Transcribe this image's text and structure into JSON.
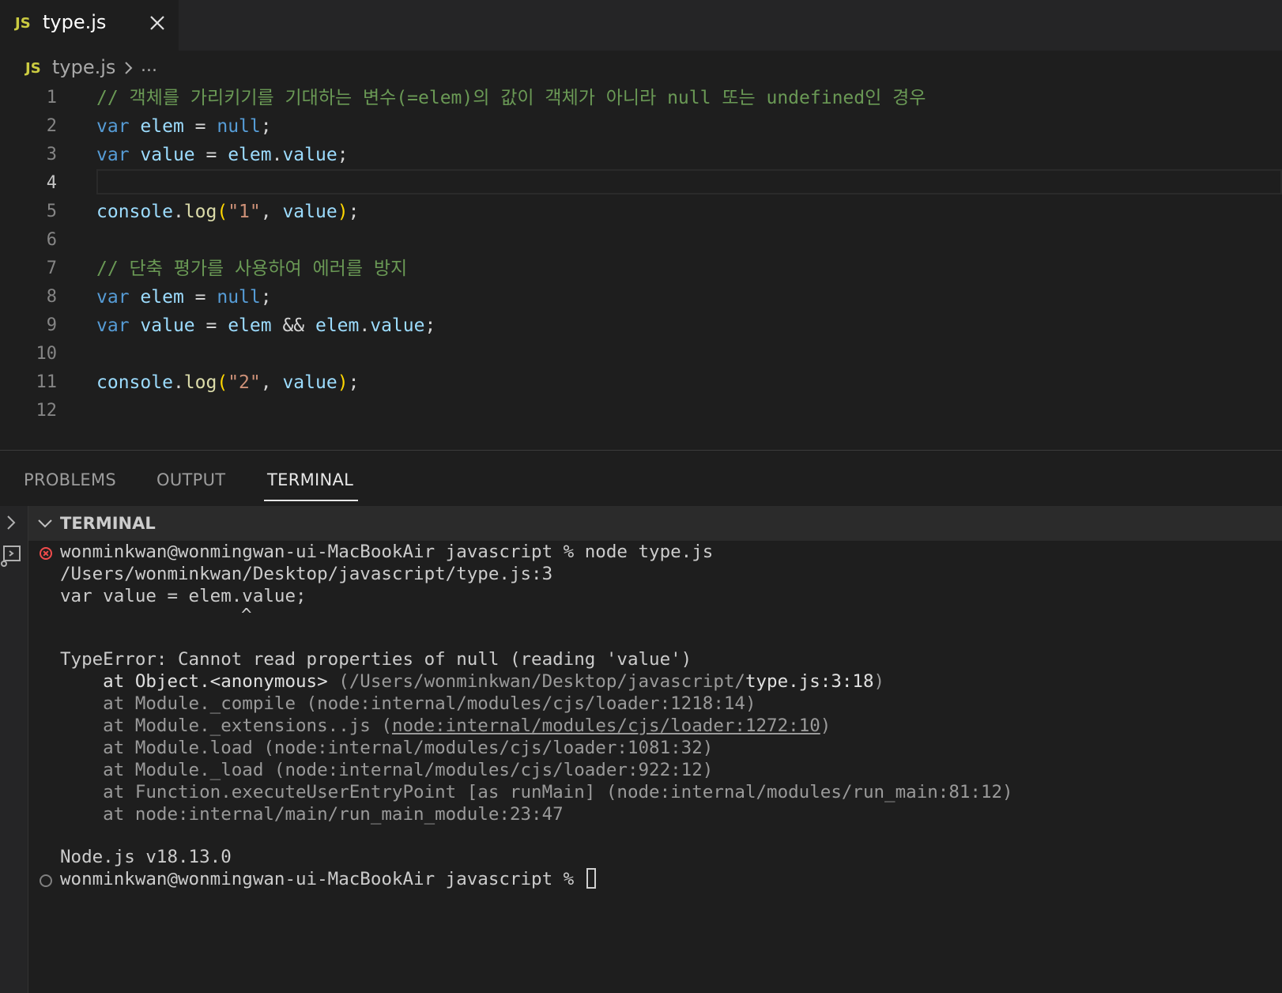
{
  "tab": {
    "icon_label": "JS",
    "filename": "type.js"
  },
  "breadcrumb": {
    "icon_label": "JS",
    "file": "type.js",
    "more": "..."
  },
  "editor": {
    "active_line": 4,
    "lines": [
      {
        "n": "1",
        "tokens": [
          {
            "t": "// 객체를 가리키기를 기대하는 변수(=elem)의 값이 객체가 아니라 null 또는 undefined인 경우",
            "c": "cmt"
          }
        ]
      },
      {
        "n": "2",
        "tokens": [
          {
            "t": "var",
            "c": "kw"
          },
          {
            "t": " ",
            "c": "pl"
          },
          {
            "t": "elem",
            "c": "var"
          },
          {
            "t": " = ",
            "c": "pl"
          },
          {
            "t": "null",
            "c": "kw"
          },
          {
            "t": ";",
            "c": "pl"
          }
        ]
      },
      {
        "n": "3",
        "tokens": [
          {
            "t": "var",
            "c": "kw"
          },
          {
            "t": " ",
            "c": "pl"
          },
          {
            "t": "value",
            "c": "var"
          },
          {
            "t": " = ",
            "c": "pl"
          },
          {
            "t": "elem",
            "c": "var"
          },
          {
            "t": ".",
            "c": "pl"
          },
          {
            "t": "value",
            "c": "var"
          },
          {
            "t": ";",
            "c": "pl"
          }
        ]
      },
      {
        "n": "4",
        "tokens": []
      },
      {
        "n": "5",
        "tokens": [
          {
            "t": "console",
            "c": "var"
          },
          {
            "t": ".",
            "c": "pl"
          },
          {
            "t": "log",
            "c": "fn"
          },
          {
            "t": "(",
            "c": "br"
          },
          {
            "t": "\"1\"",
            "c": "str"
          },
          {
            "t": ", ",
            "c": "pl"
          },
          {
            "t": "value",
            "c": "var"
          },
          {
            "t": ")",
            "c": "br"
          },
          {
            "t": ";",
            "c": "pl"
          }
        ]
      },
      {
        "n": "6",
        "tokens": []
      },
      {
        "n": "7",
        "tokens": [
          {
            "t": "// 단축 평가를 사용하여 에러를 방지",
            "c": "cmt"
          }
        ]
      },
      {
        "n": "8",
        "tokens": [
          {
            "t": "var",
            "c": "kw"
          },
          {
            "t": " ",
            "c": "pl"
          },
          {
            "t": "elem",
            "c": "var"
          },
          {
            "t": " = ",
            "c": "pl"
          },
          {
            "t": "null",
            "c": "kw"
          },
          {
            "t": ";",
            "c": "pl"
          }
        ]
      },
      {
        "n": "9",
        "tokens": [
          {
            "t": "var",
            "c": "kw"
          },
          {
            "t": " ",
            "c": "pl"
          },
          {
            "t": "value",
            "c": "var"
          },
          {
            "t": " = ",
            "c": "pl"
          },
          {
            "t": "elem",
            "c": "var"
          },
          {
            "t": " && ",
            "c": "pl"
          },
          {
            "t": "elem",
            "c": "var"
          },
          {
            "t": ".",
            "c": "pl"
          },
          {
            "t": "value",
            "c": "var"
          },
          {
            "t": ";",
            "c": "pl"
          }
        ]
      },
      {
        "n": "10",
        "tokens": []
      },
      {
        "n": "11",
        "tokens": [
          {
            "t": "console",
            "c": "var"
          },
          {
            "t": ".",
            "c": "pl"
          },
          {
            "t": "log",
            "c": "fn"
          },
          {
            "t": "(",
            "c": "br"
          },
          {
            "t": "\"2\"",
            "c": "str"
          },
          {
            "t": ", ",
            "c": "pl"
          },
          {
            "t": "value",
            "c": "var"
          },
          {
            "t": ")",
            "c": "br"
          },
          {
            "t": ";",
            "c": "pl"
          }
        ]
      },
      {
        "n": "12",
        "tokens": []
      }
    ]
  },
  "panel": {
    "tabs": {
      "problems": "PROBLEMS",
      "output": "OUTPUT",
      "terminal": "TERMINAL"
    },
    "terminal_header": "TERMINAL"
  },
  "terminal": {
    "prompt_cmd": "wonminkwan@wonmingwan-ui-MacBookAir javascript % node type.js",
    "path_line": "/Users/wonminkwan/Desktop/javascript/type.js:3",
    "source_line": "var value = elem.value;",
    "caret": "^",
    "error_line": "TypeError: Cannot read properties of null (reading 'value')",
    "stack_1_a": "    at Object.<anonymous> ",
    "stack_1_b": "(/Users/wonminkwan/Desktop/javascript/",
    "stack_1_c": "type.js:3:18",
    "stack_1_d": ")",
    "stack_2": "    at Module._compile (node:internal/modules/cjs/loader:1218:14)",
    "stack_3_a": "    at Module._extensions..js (",
    "stack_3_b": "node:internal/modules/cjs/loader:1272:10",
    "stack_3_c": ")",
    "stack_4": "    at Module.load (node:internal/modules/cjs/loader:1081:32)",
    "stack_5": "    at Module._load (node:internal/modules/cjs/loader:922:12)",
    "stack_6": "    at Function.executeUserEntryPoint [as runMain] (node:internal/modules/run_main:81:12)",
    "stack_7": "    at node:internal/main/run_main_module:23:47",
    "node_version": "Node.js v18.13.0",
    "prompt_idle": "wonminkwan@wonmingwan-ui-MacBookAir javascript % "
  }
}
